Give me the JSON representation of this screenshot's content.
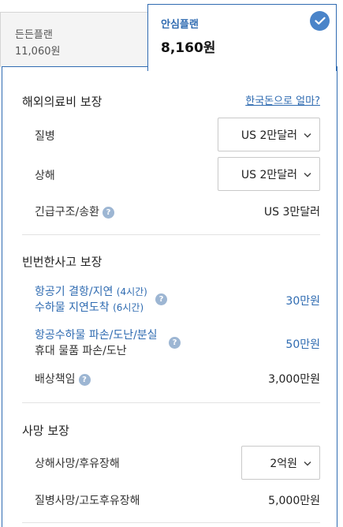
{
  "plans": {
    "basic": {
      "name": "든든플랜",
      "price": "11,060원"
    },
    "selected": {
      "name": "안심플랜",
      "price": "8,160원"
    }
  },
  "overseas_medical": {
    "title": "해외의료비 보장",
    "fx_link": "한국돈으로 얼마?",
    "illness_label": "질병",
    "illness_value": "US 2만달러",
    "injury_label": "상해",
    "injury_value": "US 2만달러",
    "rescue_label": "긴급구조/송환",
    "rescue_value": "US 3만달러"
  },
  "frequent_accidents": {
    "title": "빈번한사고 보장",
    "delay_line1": "항공기 결항/지연",
    "delay_line1_note": "(4시간)",
    "delay_line2": "수하물 지연도착",
    "delay_line2_note": "(6시간)",
    "delay_value": "30만원",
    "baggage_line1": "항공수하물 파손/도난/분실",
    "baggage_line2": "휴대 물품 파손/도난",
    "baggage_value": "50만원",
    "liability_label": "배상책임",
    "liability_value": "3,000만원"
  },
  "death": {
    "title": "사망 보장",
    "accident_label": "상해사망/후유장해",
    "accident_value": "2억원",
    "illness_label": "질병사망/고도후유장해",
    "illness_value": "5,000만원"
  },
  "icons": {
    "info": "?"
  },
  "colors": {
    "accent": "#2f6bb1",
    "check_bg": "#4a84c9",
    "info_bg": "#9db6d3"
  }
}
